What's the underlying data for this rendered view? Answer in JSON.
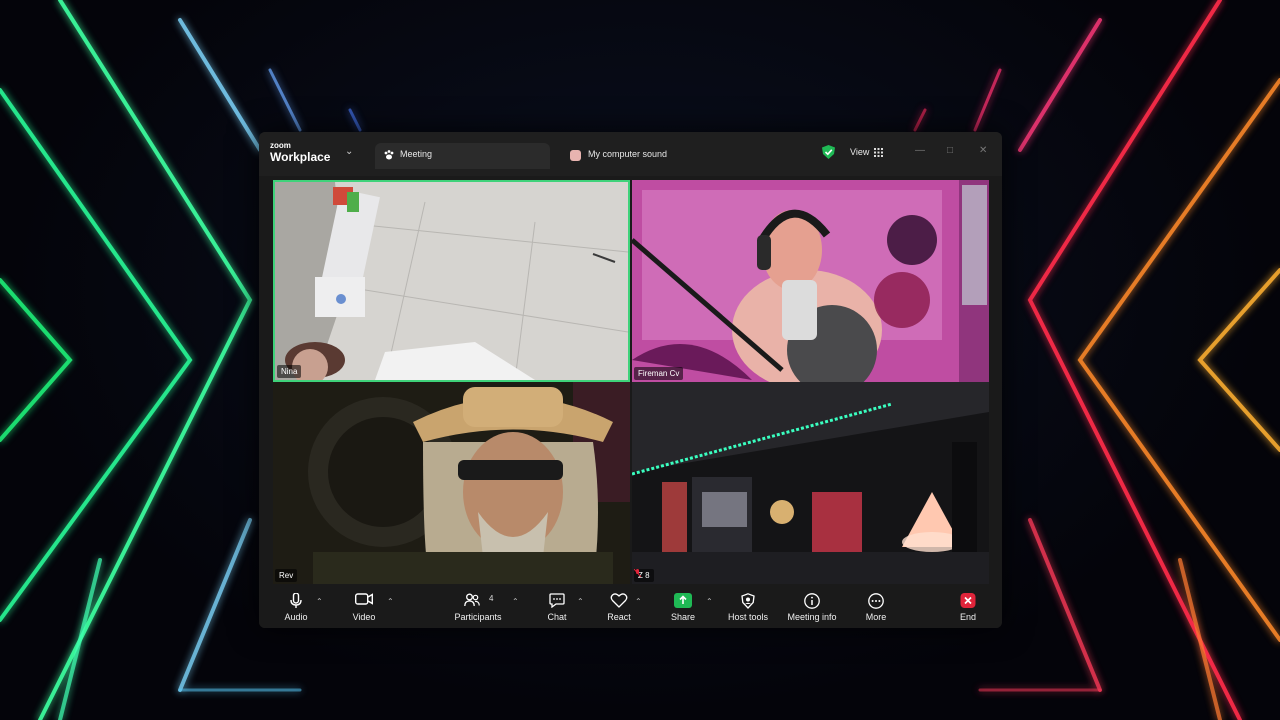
{
  "app": {
    "brand_small": "zoom",
    "brand_big": "Workplace"
  },
  "tabs": [
    {
      "label": "Meeting",
      "active": true
    },
    {
      "label": "My computer sound",
      "active": false
    }
  ],
  "header": {
    "view_label": "View",
    "security": "encrypted"
  },
  "participants": [
    {
      "name": "Nina",
      "active_speaker": true
    },
    {
      "name": "Fireman Cv",
      "active_speaker": false
    },
    {
      "name": "Rev",
      "active_speaker": false
    },
    {
      "name": "Z 8",
      "muted": true
    }
  ],
  "toolbar": {
    "audio": "Audio",
    "video": "Video",
    "participants": "Participants",
    "participant_count": "4",
    "chat": "Chat",
    "react": "React",
    "share": "Share",
    "host_tools": "Host tools",
    "meeting_info": "Meeting info",
    "more": "More",
    "end": "End"
  },
  "colors": {
    "active_speaker_border": "#3fd27a",
    "share_green": "#1fb955",
    "end_red": "#e0243a"
  }
}
